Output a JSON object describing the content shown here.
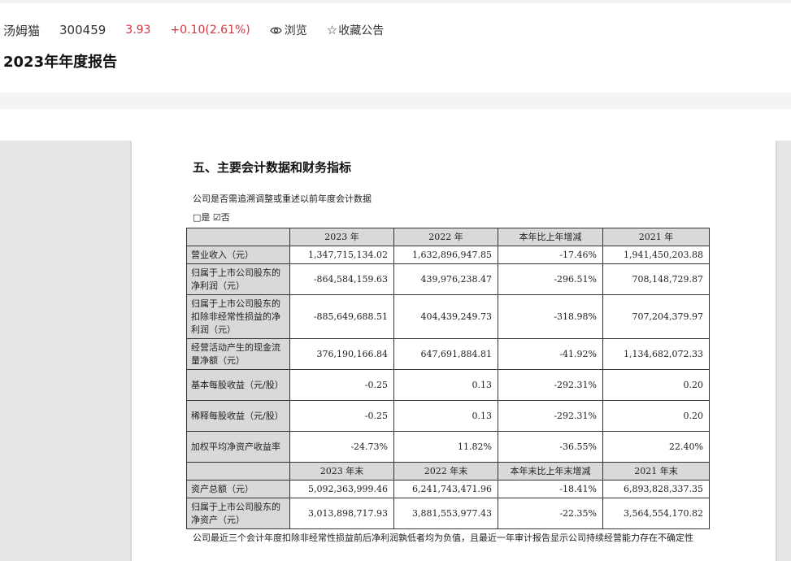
{
  "header": {
    "stock_name": "汤姆猫",
    "stock_code": "300459",
    "price": "3.93",
    "change": "+0.10(2.61%)",
    "browse_label": "浏览",
    "favorite_label": "收藏公告",
    "report_title": "2023年年度报告"
  },
  "doc": {
    "section_title": "五、主要会计数据和财务指标",
    "question": "公司是否需追溯调整或重述以前年度会计数据",
    "answer": "□是 ☑否",
    "table": {
      "header1": [
        "",
        "2023 年",
        "2022 年",
        "本年比上年增减",
        "2021 年"
      ],
      "rows1": [
        [
          "营业收入（元）",
          "1,347,715,134.02",
          "1,632,896,947.85",
          "-17.46%",
          "1,941,450,203.88"
        ],
        [
          "归属于上市公司股东的净利润（元）",
          "-864,584,159.63",
          "439,976,238.47",
          "-296.51%",
          "708,148,729.87"
        ],
        [
          "归属于上市公司股东的扣除非经常性损益的净利润（元）",
          "-885,649,688.51",
          "404,439,249.73",
          "-318.98%",
          "707,204,379.97"
        ],
        [
          "经营活动产生的现金流量净额（元）",
          "376,190,166.84",
          "647,691,884.81",
          "-41.92%",
          "1,134,682,072.33"
        ],
        [
          "基本每股收益（元/股）",
          "-0.25",
          "0.13",
          "-292.31%",
          "0.20"
        ],
        [
          "稀释每股收益（元/股）",
          "-0.25",
          "0.13",
          "-292.31%",
          "0.20"
        ],
        [
          "加权平均净资产收益率",
          "-24.73%",
          "11.82%",
          "-36.55%",
          "22.40%"
        ]
      ],
      "header2": [
        "",
        "2023 年末",
        "2022 年末",
        "本年末比上年末增减",
        "2021 年末"
      ],
      "rows2": [
        [
          "资产总额（元）",
          "5,092,363,999.46",
          "6,241,743,471.96",
          "-18.41%",
          "6,893,828,337.35"
        ],
        [
          "归属于上市公司股东的净资产（元）",
          "3,013,898,717.93",
          "3,881,553,977.43",
          "-22.35%",
          "3,564,554,170.82"
        ]
      ]
    },
    "note": "公司最近三个会计年度扣除非经常性损益前后净利润孰低者均为负值，且最近一年审计报告显示公司持续经营能力存在不确定性"
  },
  "colors": {
    "price_red": "#d9333f",
    "header_gray": "#d9d9d9",
    "viewer_bg": "#e6e6e6"
  }
}
